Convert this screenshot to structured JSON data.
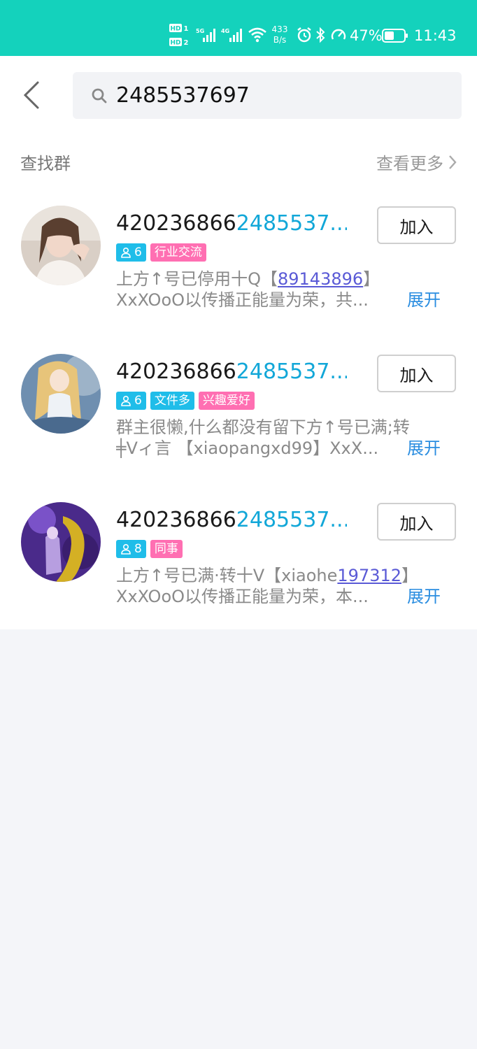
{
  "status_bar": {
    "hd1": "HD 1",
    "hd2": "HD 2",
    "net1": "5G",
    "net2": "4G",
    "speed_value": "433",
    "speed_unit": "B/s",
    "battery": "47%",
    "time": "11:43"
  },
  "search": {
    "query": "2485537697"
  },
  "section": {
    "title": "查找群",
    "more_label": "查看更多"
  },
  "groups": [
    {
      "name_prefix": "420236866",
      "name_highlight": "2485537...",
      "members": "6",
      "tags": [
        "行业交流"
      ],
      "desc_line1_before": "上方↑号已停用十Q【",
      "desc_line1_link": "89143896",
      "desc_line1_after": "】",
      "desc_line2": "XxXOoO以传播正能量为荣，共...",
      "expand_label": "展开",
      "join_label": "加入"
    },
    {
      "name_prefix": "420236866",
      "name_highlight": "2485537...",
      "members": "6",
      "tags": [
        "文件多",
        "兴趣爱好"
      ],
      "desc_line1_before": "群主很懒,什么都没有留下方↑号已满;转",
      "desc_line1_link": "",
      "desc_line1_after": "",
      "desc_line2": "╪Vィ言 【xiaopangxd99】XxX...",
      "expand_label": "展开",
      "join_label": "加入"
    },
    {
      "name_prefix": "420236866",
      "name_highlight": "2485537...",
      "members": "8",
      "tags": [
        "同事"
      ],
      "desc_line1_before": "上方↑号已满·转十V【xiaohe",
      "desc_line1_link": "197312",
      "desc_line1_after": "】",
      "desc_line2": "XxXOoO以传播正能量为荣，本...",
      "expand_label": "展开",
      "join_label": "加入"
    }
  ],
  "colors": {
    "status_bar_bg": "#14d2bc",
    "highlight": "#12a7d8",
    "tag_blue": "#1fbde9",
    "tag_pink": "#ff6fb2",
    "link": "#2a8de0"
  }
}
